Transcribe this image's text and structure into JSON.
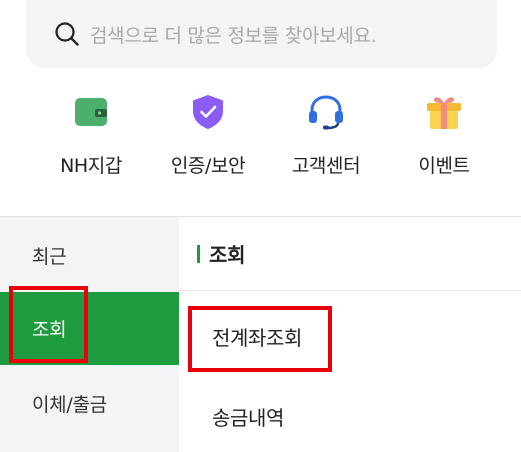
{
  "search": {
    "placeholder": "검색으로 더 많은 정보를 찾아보세요.",
    "icon": "search-icon"
  },
  "quick_menu": [
    {
      "label": "NH지갑",
      "icon": "wallet-icon",
      "color": "#4caf6e"
    },
    {
      "label": "인증/보안",
      "icon": "shield-check-icon",
      "color": "#8b5cf6"
    },
    {
      "label": "고객센터",
      "icon": "headset-icon",
      "color": "#2f6fe0"
    },
    {
      "label": "이벤트",
      "icon": "gift-icon",
      "color": "#f7b733"
    }
  ],
  "left_menu": [
    {
      "label": "최근",
      "active": false
    },
    {
      "label": "조회",
      "active": true
    },
    {
      "label": "이체/출금",
      "active": false
    }
  ],
  "section": {
    "title": "조회",
    "items": [
      "전계좌조회",
      "송금내역"
    ]
  },
  "colors": {
    "accent": "#1e9a3f",
    "highlight": "#e8000b"
  }
}
